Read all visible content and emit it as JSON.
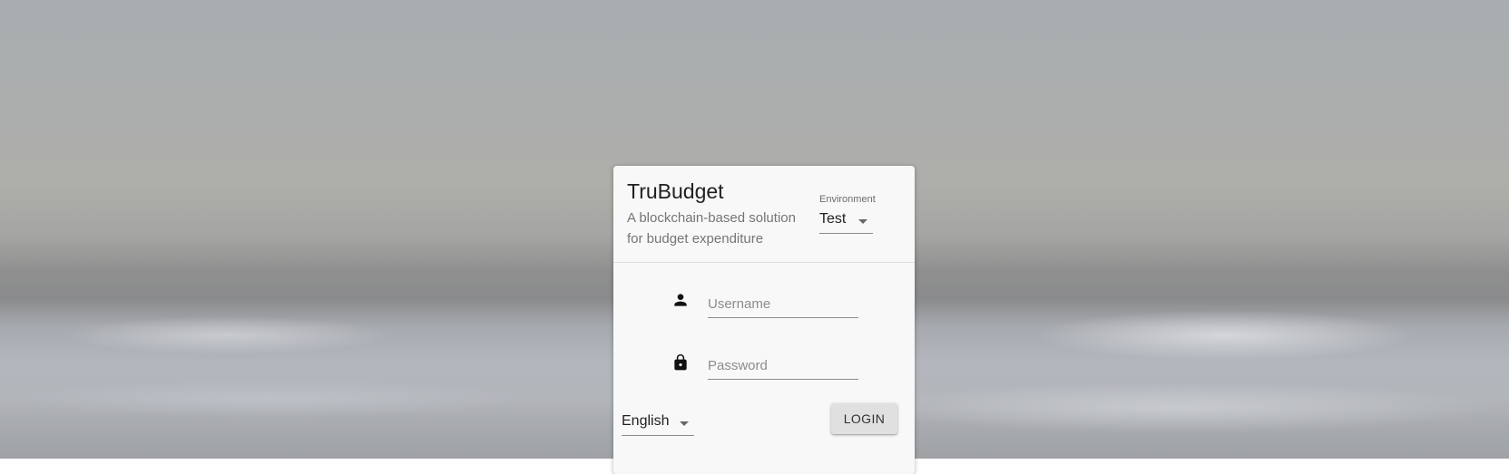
{
  "login_card": {
    "title": "TruBudget",
    "subtitle": "A blockchain-based solution for budget expenditure",
    "environment": {
      "label": "Environment",
      "selected": "Test"
    },
    "username": {
      "placeholder": "Username",
      "value": "",
      "icon": "person-icon"
    },
    "password": {
      "placeholder": "Password",
      "value": "",
      "icon": "lock-icon"
    },
    "language": {
      "selected": "English"
    },
    "login_label": "LOGIN"
  }
}
